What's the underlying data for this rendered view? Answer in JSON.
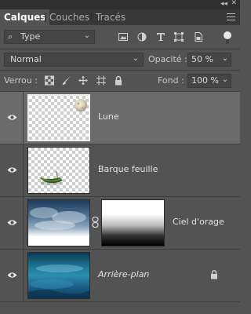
{
  "panel": {
    "tabs": [
      {
        "label": "Calques",
        "active": true
      },
      {
        "label": "Couches",
        "active": false
      },
      {
        "label": "Tracés",
        "active": false
      }
    ]
  },
  "filter": {
    "kind_label": "Type",
    "icon_names": [
      "image-filter-icon",
      "adjustment-filter-icon",
      "type-filter-icon",
      "shape-filter-icon",
      "smart-object-filter-icon"
    ]
  },
  "blend": {
    "mode": "Normal",
    "opacity_label": "Opacité :",
    "opacity_value": "50 %"
  },
  "lock": {
    "label": "Verrou :",
    "icon_names": [
      "lock-transparent-pixels-icon",
      "lock-image-pixels-icon",
      "lock-position-icon",
      "lock-artboard-icon",
      "lock-all-icon"
    ],
    "fill_label": "Fond :",
    "fill_value": "100 %"
  },
  "layers": [
    {
      "name": "Lune",
      "selected": true,
      "visible": true,
      "italic": false,
      "has_mask": false,
      "locked": false
    },
    {
      "name": "Barque feuille",
      "selected": false,
      "visible": true,
      "italic": false,
      "has_mask": false,
      "locked": false
    },
    {
      "name": "Ciel d'orage",
      "selected": false,
      "visible": true,
      "italic": false,
      "has_mask": true,
      "locked": false
    },
    {
      "name": "Arrière-plan",
      "selected": false,
      "visible": true,
      "italic": true,
      "has_mask": false,
      "locked": true
    }
  ],
  "colors": {
    "panel_bg": "#535353",
    "selected_layer_bg": "#6b6b6b",
    "tab_bar_bg": "#383838",
    "field_bg": "#454545"
  }
}
